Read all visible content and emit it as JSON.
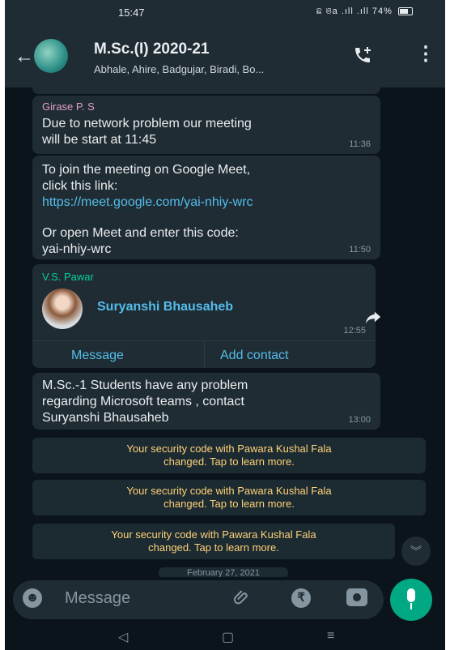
{
  "status": {
    "time": "15:47",
    "battery": "74%",
    "signal": "ଛ ଞa .ıll .ıll"
  },
  "header": {
    "back_icon": "←",
    "title": "M.Sc.(I) 2020-21",
    "subtitle": "Abhale, Ahire, Badgujar, Biradi, Bo...",
    "call_icon": "add-call-icon",
    "menu_icon": "⋮"
  },
  "messages": [
    {
      "sender": "Girase P. S",
      "sender_color": "#e2a0c8",
      "text": "Due to network problem our meeting\nwill be start at 11:45",
      "time": "11:36"
    },
    {
      "text_before": "To join the meeting on Google Meet,\nclick this link:",
      "link": "https://meet.google.com/yai-nhiy-wrc",
      "text_after": "Or open Meet and enter this code:\nyai-nhiy-wrc",
      "time": "11:50"
    }
  ],
  "contact_card": {
    "sender": "V.S. Pawar",
    "sender_color": "#06cf9c",
    "name": "Suryanshi Bhausaheb",
    "time": "12:55",
    "message_button": "Message",
    "add_button": "Add contact"
  },
  "message3": {
    "text": "M.Sc.-1 Students have any problem\nregarding Microsoft teams , contact\nSuryanshi Bhausaheb",
    "time": "13:00"
  },
  "system_notes": [
    {
      "line1": "Your security code with Pawara Kushal Fala",
      "line2": "changed. Tap to learn more."
    },
    {
      "line1": "Your security code with Pawara Kushal Fala",
      "line2": "changed. Tap to learn more."
    },
    {
      "line1": "Your security code with Pawara Kushal Fala",
      "line2": "changed. Tap to learn more."
    }
  ],
  "date_chip": "February 27, 2021",
  "input": {
    "placeholder": "Message"
  },
  "colors": {
    "header": "#1f2c33",
    "chat_bg": "#0b141a",
    "bubble": "#202c33",
    "accent": "#00a884",
    "link": "#53bdeb",
    "system_text": "#ffd279"
  }
}
